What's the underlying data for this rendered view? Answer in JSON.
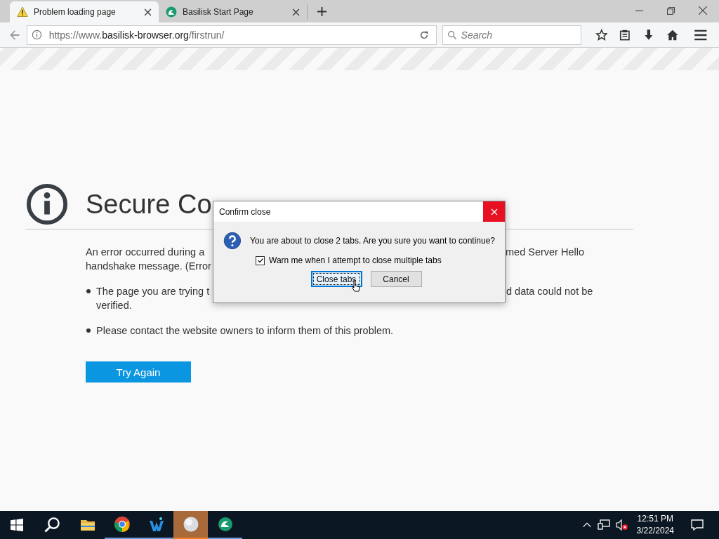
{
  "tabs": [
    {
      "title": "Problem loading page",
      "kind": "warning",
      "selected": true
    },
    {
      "title": "Basilisk Start Page",
      "kind": "basilisk",
      "selected": false
    }
  ],
  "toolbar": {
    "url_prefix": "https://www.",
    "url_domain": "basilisk-browser.org",
    "url_path": "/firstrun/",
    "search_placeholder": "Search"
  },
  "error_page": {
    "title": "Secure Co",
    "lines": [
      {
        "left": "An error occurred during a",
        "right": "med Server Hello"
      },
      {
        "left": "handshake message. (Error"
      }
    ],
    "bullets": [
      {
        "left": "The page you are trying t",
        "right": "d data could not be",
        "continuation": "verified."
      },
      {
        "left": "Please contact the website owners to inform them of this problem."
      }
    ],
    "button": "Try Again"
  },
  "dialog": {
    "title": "Confirm close",
    "message": "You are about to close 2 tabs. Are you sure you want to continue?",
    "checkbox": {
      "label": "Warn me when I attempt to close multiple tabs",
      "checked": true
    },
    "buttons": [
      {
        "label": "Close tabs",
        "selected": true
      },
      {
        "label": "Cancel",
        "selected": false
      }
    ]
  },
  "taskbar": {
    "apps": [
      {
        "kind": "folder",
        "active": false
      },
      {
        "kind": "chrome",
        "active": false
      },
      {
        "kind": "w",
        "active": false
      },
      {
        "kind": "orb",
        "active": true
      },
      {
        "kind": "basilisk",
        "active": false
      }
    ],
    "time": "12:51 PM",
    "date": "3/22/2024"
  }
}
